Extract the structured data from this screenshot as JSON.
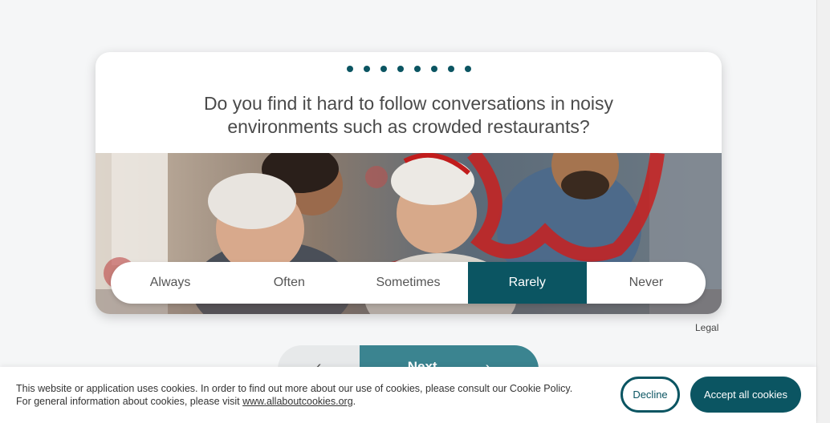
{
  "progress": {
    "total_steps": 8
  },
  "question": {
    "line1": "Do you find it hard to follow conversations in noisy",
    "line2": "environments such as crowded restaurants?"
  },
  "options": [
    "Always",
    "Often",
    "Sometimes",
    "Rarely",
    "Never"
  ],
  "selected_option": "Rarely",
  "legal_link": "Legal",
  "navigation": {
    "next_label": "Next",
    "back_icon": "chevron-left-icon",
    "next_icon": "chevron-right-icon"
  },
  "cookie_banner": {
    "text_part1": "This website or application uses cookies. In order to find out more about our use of cookies, please consult our Cookie Policy. For general information about cookies, please visit ",
    "link_text": "www.allaboutcookies.org",
    "text_part2": ".",
    "decline_label": "Decline",
    "accept_label": "Accept all cookies"
  },
  "colors": {
    "accent": "#0b5562",
    "next_button": "#3b8490",
    "background": "#f5f6f7"
  }
}
